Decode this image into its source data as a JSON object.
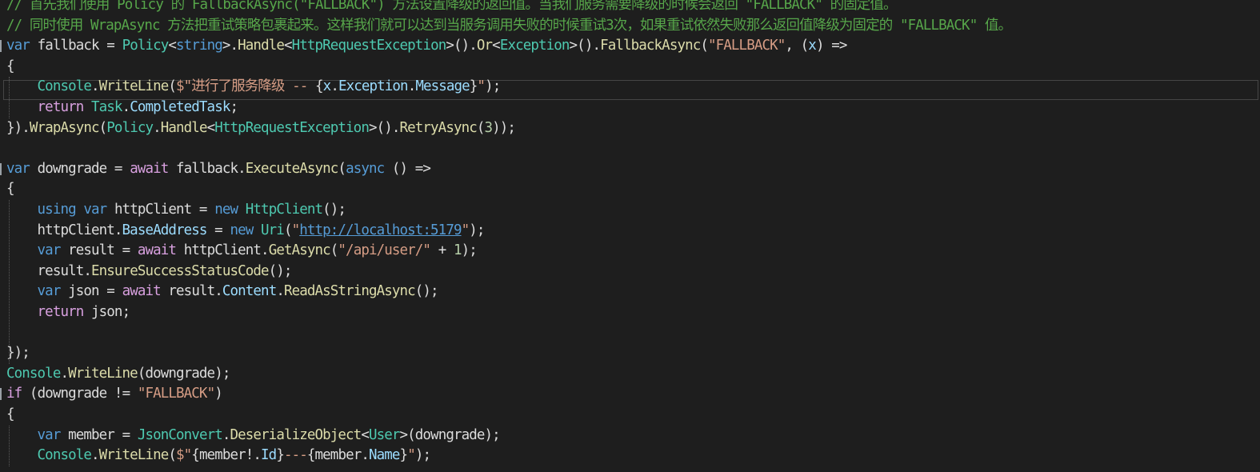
{
  "editor": {
    "language": "csharp",
    "current_line_index": 4,
    "colors": {
      "background": "#1e1e1e",
      "comment": "#57a64a",
      "keyword": "#569cd6",
      "control_keyword": "#d8a0df",
      "type": "#4ec9b0",
      "method": "#dcdcaa",
      "string": "#d69d85",
      "number": "#b5cea8",
      "link": "#569cd6"
    },
    "lines": [
      {
        "fold": false,
        "tokens": [
          {
            "c": "comment",
            "t": "// 首先我们使用 Policy 的 FallbackAsync(\"FALLBACK\") 方法设置降级的返回值。当我们服务需要降级的时候会返回 \"FALLBACK\" 的固定值。"
          }
        ]
      },
      {
        "fold": false,
        "tokens": [
          {
            "c": "comment",
            "t": "// 同时使用 WrapAsync 方法把重试策略包裹起来。这样我们就可以达到当服务调用失败的时候重试3次，如果重试依然失败那么返回值降级为固定的 \"FALLBACK\" 值。"
          }
        ]
      },
      {
        "fold": true,
        "tokens": [
          {
            "c": "kw",
            "t": "var"
          },
          {
            "c": "plain",
            "t": " "
          },
          {
            "c": "local",
            "t": "fallback"
          },
          {
            "c": "plain",
            "t": " = "
          },
          {
            "c": "type",
            "t": "Policy"
          },
          {
            "c": "plain",
            "t": "<"
          },
          {
            "c": "kw",
            "t": "string"
          },
          {
            "c": "plain",
            "t": ">."
          },
          {
            "c": "method",
            "t": "Handle"
          },
          {
            "c": "plain",
            "t": "<"
          },
          {
            "c": "type",
            "t": "HttpRequestException"
          },
          {
            "c": "plain",
            "t": ">()."
          },
          {
            "c": "method",
            "t": "Or"
          },
          {
            "c": "plain",
            "t": "<"
          },
          {
            "c": "type",
            "t": "Exception"
          },
          {
            "c": "plain",
            "t": ">()."
          },
          {
            "c": "method",
            "t": "FallbackAsync"
          },
          {
            "c": "plain",
            "t": "("
          },
          {
            "c": "str",
            "t": "\"FALLBACK\""
          },
          {
            "c": "plain",
            "t": ", ("
          },
          {
            "c": "var",
            "t": "x"
          },
          {
            "c": "plain",
            "t": ") =>"
          }
        ]
      },
      {
        "fold": false,
        "tokens": [
          {
            "c": "plain",
            "t": "{"
          }
        ]
      },
      {
        "fold": false,
        "tokens": [
          {
            "c": "plain",
            "t": "    "
          },
          {
            "c": "type",
            "t": "Console"
          },
          {
            "c": "plain",
            "t": "."
          },
          {
            "c": "method",
            "t": "WriteLine"
          },
          {
            "c": "plain",
            "t": "("
          },
          {
            "c": "str",
            "t": "$\"进行了服务降级 -- "
          },
          {
            "c": "interp",
            "t": "{"
          },
          {
            "c": "var",
            "t": "x"
          },
          {
            "c": "interp",
            "t": "."
          },
          {
            "c": "var",
            "t": "Exception"
          },
          {
            "c": "interp",
            "t": "."
          },
          {
            "c": "var",
            "t": "Message"
          },
          {
            "c": "interp",
            "t": "}"
          },
          {
            "c": "str",
            "t": "\""
          },
          {
            "c": "plain",
            "t": ");"
          }
        ]
      },
      {
        "fold": false,
        "tokens": [
          {
            "c": "plain",
            "t": "    "
          },
          {
            "c": "ctrl",
            "t": "return"
          },
          {
            "c": "plain",
            "t": " "
          },
          {
            "c": "type",
            "t": "Task"
          },
          {
            "c": "plain",
            "t": "."
          },
          {
            "c": "var",
            "t": "CompletedTask"
          },
          {
            "c": "plain",
            "t": ";"
          }
        ]
      },
      {
        "fold": false,
        "tokens": [
          {
            "c": "plain",
            "t": "})."
          },
          {
            "c": "method",
            "t": "WrapAsync"
          },
          {
            "c": "plain",
            "t": "("
          },
          {
            "c": "type",
            "t": "Policy"
          },
          {
            "c": "plain",
            "t": "."
          },
          {
            "c": "method",
            "t": "Handle"
          },
          {
            "c": "plain",
            "t": "<"
          },
          {
            "c": "type",
            "t": "HttpRequestException"
          },
          {
            "c": "plain",
            "t": ">()."
          },
          {
            "c": "method",
            "t": "RetryAsync"
          },
          {
            "c": "plain",
            "t": "("
          },
          {
            "c": "num",
            "t": "3"
          },
          {
            "c": "plain",
            "t": "));"
          }
        ]
      },
      {
        "fold": false,
        "tokens": []
      },
      {
        "fold": true,
        "tokens": [
          {
            "c": "kw",
            "t": "var"
          },
          {
            "c": "plain",
            "t": " "
          },
          {
            "c": "local",
            "t": "downgrade"
          },
          {
            "c": "plain",
            "t": " = "
          },
          {
            "c": "ctrl",
            "t": "await"
          },
          {
            "c": "plain",
            "t": " "
          },
          {
            "c": "local",
            "t": "fallback"
          },
          {
            "c": "plain",
            "t": "."
          },
          {
            "c": "method",
            "t": "ExecuteAsync"
          },
          {
            "c": "plain",
            "t": "("
          },
          {
            "c": "kw",
            "t": "async"
          },
          {
            "c": "plain",
            "t": " () =>"
          }
        ]
      },
      {
        "fold": false,
        "tokens": [
          {
            "c": "plain",
            "t": "{"
          }
        ]
      },
      {
        "fold": false,
        "tokens": [
          {
            "c": "plain",
            "t": "    "
          },
          {
            "c": "kw",
            "t": "using"
          },
          {
            "c": "plain",
            "t": " "
          },
          {
            "c": "kw",
            "t": "var"
          },
          {
            "c": "plain",
            "t": " "
          },
          {
            "c": "local",
            "t": "httpClient"
          },
          {
            "c": "plain",
            "t": " = "
          },
          {
            "c": "kw",
            "t": "new"
          },
          {
            "c": "plain",
            "t": " "
          },
          {
            "c": "type",
            "t": "HttpClient"
          },
          {
            "c": "plain",
            "t": "();"
          }
        ]
      },
      {
        "fold": false,
        "tokens": [
          {
            "c": "plain",
            "t": "    "
          },
          {
            "c": "local",
            "t": "httpClient"
          },
          {
            "c": "plain",
            "t": "."
          },
          {
            "c": "var",
            "t": "BaseAddress"
          },
          {
            "c": "plain",
            "t": " = "
          },
          {
            "c": "kw",
            "t": "new"
          },
          {
            "c": "plain",
            "t": " "
          },
          {
            "c": "type",
            "t": "Uri"
          },
          {
            "c": "plain",
            "t": "("
          },
          {
            "c": "str",
            "t": "\""
          },
          {
            "c": "link",
            "t": "http://localhost:5179"
          },
          {
            "c": "str",
            "t": "\""
          },
          {
            "c": "plain",
            "t": ");"
          }
        ]
      },
      {
        "fold": false,
        "tokens": [
          {
            "c": "plain",
            "t": "    "
          },
          {
            "c": "kw",
            "t": "var"
          },
          {
            "c": "plain",
            "t": " "
          },
          {
            "c": "local",
            "t": "result"
          },
          {
            "c": "plain",
            "t": " = "
          },
          {
            "c": "ctrl",
            "t": "await"
          },
          {
            "c": "plain",
            "t": " "
          },
          {
            "c": "local",
            "t": "httpClient"
          },
          {
            "c": "plain",
            "t": "."
          },
          {
            "c": "method",
            "t": "GetAsync"
          },
          {
            "c": "plain",
            "t": "("
          },
          {
            "c": "str",
            "t": "\"/api/user/\""
          },
          {
            "c": "plain",
            "t": " + "
          },
          {
            "c": "num",
            "t": "1"
          },
          {
            "c": "plain",
            "t": ");"
          }
        ]
      },
      {
        "fold": false,
        "tokens": [
          {
            "c": "plain",
            "t": "    "
          },
          {
            "c": "local",
            "t": "result"
          },
          {
            "c": "plain",
            "t": "."
          },
          {
            "c": "method",
            "t": "EnsureSuccessStatusCode"
          },
          {
            "c": "plain",
            "t": "();"
          }
        ]
      },
      {
        "fold": false,
        "tokens": [
          {
            "c": "plain",
            "t": "    "
          },
          {
            "c": "kw",
            "t": "var"
          },
          {
            "c": "plain",
            "t": " "
          },
          {
            "c": "local",
            "t": "json"
          },
          {
            "c": "plain",
            "t": " = "
          },
          {
            "c": "ctrl",
            "t": "await"
          },
          {
            "c": "plain",
            "t": " "
          },
          {
            "c": "local",
            "t": "result"
          },
          {
            "c": "plain",
            "t": "."
          },
          {
            "c": "var",
            "t": "Content"
          },
          {
            "c": "plain",
            "t": "."
          },
          {
            "c": "method",
            "t": "ReadAsStringAsync"
          },
          {
            "c": "plain",
            "t": "();"
          }
        ]
      },
      {
        "fold": false,
        "tokens": [
          {
            "c": "plain",
            "t": "    "
          },
          {
            "c": "ctrl",
            "t": "return"
          },
          {
            "c": "plain",
            "t": " "
          },
          {
            "c": "local",
            "t": "json"
          },
          {
            "c": "plain",
            "t": ";"
          }
        ]
      },
      {
        "fold": false,
        "tokens": []
      },
      {
        "fold": false,
        "tokens": [
          {
            "c": "plain",
            "t": "});"
          }
        ]
      },
      {
        "fold": false,
        "tokens": [
          {
            "c": "type",
            "t": "Console"
          },
          {
            "c": "plain",
            "t": "."
          },
          {
            "c": "method",
            "t": "WriteLine"
          },
          {
            "c": "plain",
            "t": "("
          },
          {
            "c": "local",
            "t": "downgrade"
          },
          {
            "c": "plain",
            "t": ");"
          }
        ]
      },
      {
        "fold": true,
        "tokens": [
          {
            "c": "ctrl",
            "t": "if"
          },
          {
            "c": "plain",
            "t": " ("
          },
          {
            "c": "local",
            "t": "downgrade"
          },
          {
            "c": "plain",
            "t": " != "
          },
          {
            "c": "str",
            "t": "\"FALLBACK\""
          },
          {
            "c": "plain",
            "t": ")"
          }
        ]
      },
      {
        "fold": false,
        "tokens": [
          {
            "c": "plain",
            "t": "{"
          }
        ]
      },
      {
        "fold": false,
        "tokens": [
          {
            "c": "plain",
            "t": "    "
          },
          {
            "c": "kw",
            "t": "var"
          },
          {
            "c": "plain",
            "t": " "
          },
          {
            "c": "local",
            "t": "member"
          },
          {
            "c": "plain",
            "t": " = "
          },
          {
            "c": "type",
            "t": "JsonConvert"
          },
          {
            "c": "plain",
            "t": "."
          },
          {
            "c": "method",
            "t": "DeserializeObject"
          },
          {
            "c": "plain",
            "t": "<"
          },
          {
            "c": "type",
            "t": "User"
          },
          {
            "c": "plain",
            "t": ">("
          },
          {
            "c": "local",
            "t": "downgrade"
          },
          {
            "c": "plain",
            "t": ");"
          }
        ]
      },
      {
        "fold": false,
        "tokens": [
          {
            "c": "plain",
            "t": "    "
          },
          {
            "c": "type",
            "t": "Console"
          },
          {
            "c": "plain",
            "t": "."
          },
          {
            "c": "method",
            "t": "WriteLine"
          },
          {
            "c": "plain",
            "t": "("
          },
          {
            "c": "str",
            "t": "$\""
          },
          {
            "c": "interp",
            "t": "{"
          },
          {
            "c": "local",
            "t": "member"
          },
          {
            "c": "interp",
            "t": "!."
          },
          {
            "c": "var",
            "t": "Id"
          },
          {
            "c": "interp",
            "t": "}"
          },
          {
            "c": "str",
            "t": "---"
          },
          {
            "c": "interp",
            "t": "{"
          },
          {
            "c": "local",
            "t": "member"
          },
          {
            "c": "interp",
            "t": "."
          },
          {
            "c": "var",
            "t": "Name"
          },
          {
            "c": "interp",
            "t": "}"
          },
          {
            "c": "str",
            "t": "\""
          },
          {
            "c": "plain",
            "t": ");"
          }
        ]
      }
    ]
  }
}
